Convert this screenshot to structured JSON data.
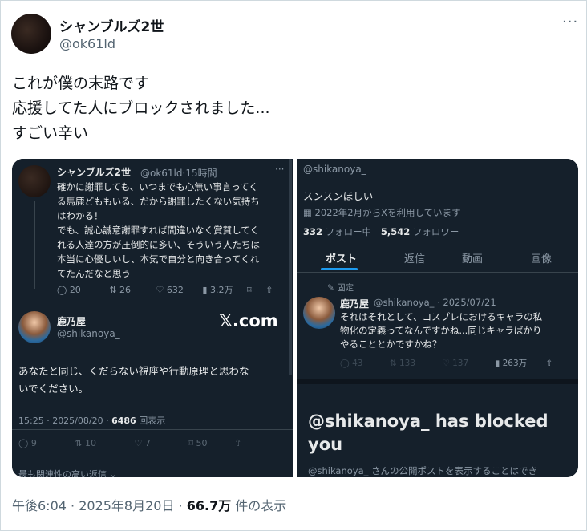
{
  "tweet": {
    "author_name": "シャンブルズ2世",
    "author_handle": "@ok61ld",
    "more": "···",
    "lines": [
      "これが僕の末路です",
      "応援してた人にブロックされました...",
      "すごい辛い"
    ],
    "time": "午後6:04 · 2025年8月20日 · ",
    "views_count": "66.7万",
    "views_label": " 件の表示"
  },
  "left_shot": {
    "top_name": "シャンブルズ2世",
    "top_meta": "@ok61ld·15時間",
    "top_more": "···",
    "top_lines": [
      "確かに謝罪しても、いつまでも心無い事言ってく",
      "る馬鹿どももいる、だから謝罪したくない気持ち",
      "はわかる！",
      "でも、誠心誠意謝罪すれば間違いなく賞賛してく",
      "れる人達の方が圧倒的に多い、そういう人たちは",
      "本当に心優しいし、本気で自分と向き合ってくれ",
      "てたんだなと思う"
    ],
    "top_stats": [
      "20",
      "26",
      "632",
      "3.2万"
    ],
    "reply_name": "鹿乃屋",
    "reply_handle": "@shikanoya_",
    "xcom": "𝕏.com",
    "reply_lines": [
      "あなたと同じ、くだらない視座や行動原理と思わな",
      "いでください。"
    ],
    "reply_time": "15:25 · 2025/08/20 · ",
    "reply_views": "6486",
    "reply_views_label": " 回表示",
    "reply_stats": [
      "9",
      "10",
      "7",
      "50"
    ],
    "bottom": "最も関連性の高い返信"
  },
  "right_shot": {
    "handle": "@shikanoya_",
    "bio": "スンスンほしい",
    "joined": "2022年2月からXを利用しています",
    "following_count": "332",
    "following_label": " フォロー中",
    "followers_count": "5,542",
    "followers_label": " フォロワー",
    "tabs": [
      "ポスト",
      "返信",
      "動画",
      "画像"
    ],
    "pinned": "固定",
    "post_name": "鹿乃屋",
    "post_meta": "@shikanoya_ · 2025/07/21",
    "post_lines": [
      "それはそれとして、コスプレにおけるキャラの私",
      "物化の定義ってなんですかね...同じキャラばかり",
      "やることとかですかね？"
    ],
    "post_stats": [
      "43",
      "133",
      "137",
      "263万"
    ],
    "blocked_title_1": "@shikanoya_ has blocked",
    "blocked_title_2": "you",
    "blocked_sub": "@shikanoya_ さんの公開ポストを表示することはでき"
  },
  "colors": {
    "accent": "#1d9bf0",
    "dark_bg": "#15202b",
    "muted": "#536471"
  }
}
